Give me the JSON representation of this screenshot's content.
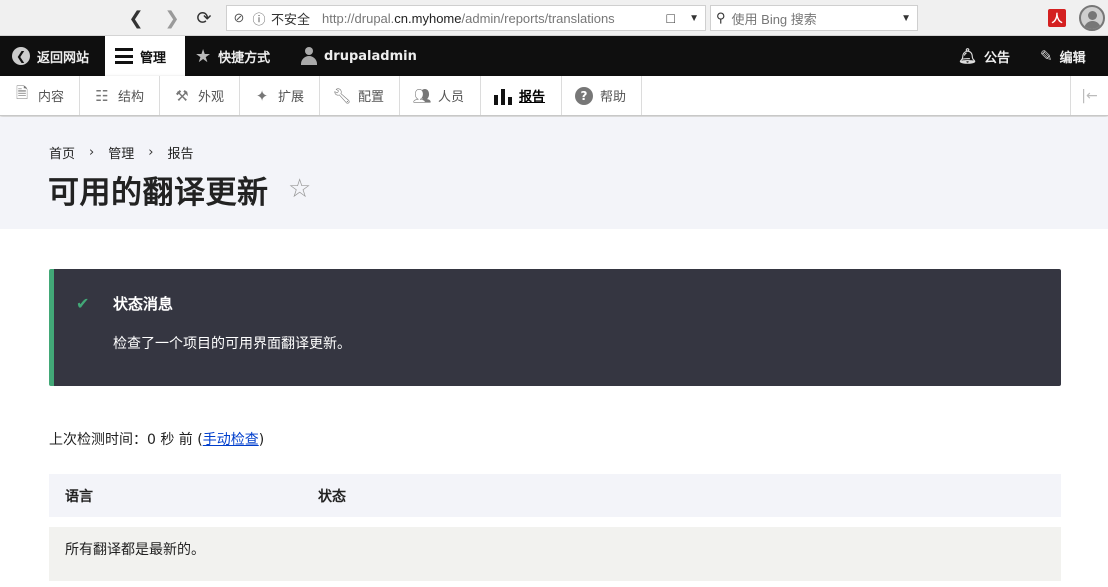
{
  "browser": {
    "insecure_label": "不安全",
    "url_prefix": "http://drupal.",
    "url_host": "cn.myhome",
    "url_path": "/admin/reports/translations",
    "search_placeholder": "使用 Bing 搜索",
    "pdf_icon_text": "人"
  },
  "toolbar": {
    "back_label": "返回网站",
    "manage_label": "管理",
    "shortcuts_label": "快捷方式",
    "user_label": "drupaladmin",
    "announcements_label": "公告",
    "edit_label": "编辑"
  },
  "tray": {
    "items": [
      {
        "label": "内容",
        "icon": "document-icon"
      },
      {
        "label": "结构",
        "icon": "sitemap-icon"
      },
      {
        "label": "外观",
        "icon": "brush-icon"
      },
      {
        "label": "扩展",
        "icon": "puzzle-icon"
      },
      {
        "label": "配置",
        "icon": "wrench-icon"
      },
      {
        "label": "人员",
        "icon": "people-icon"
      },
      {
        "label": "报告",
        "icon": "bar-chart-icon"
      },
      {
        "label": "帮助",
        "icon": "help-icon"
      }
    ]
  },
  "breadcrumb": [
    "首页",
    "管理",
    "报告"
  ],
  "page": {
    "title": "可用的翻译更新"
  },
  "status": {
    "heading": "状态消息",
    "message": "检查了一个项目的可用界面翻译更新。"
  },
  "last_check": {
    "prefix": "上次检测时间：0 秒 前 (",
    "link": "手动检查",
    "suffix": ")"
  },
  "table": {
    "headers": [
      "语言",
      "状态"
    ],
    "empty_message": "所有翻译都是最新的。"
  },
  "colors": {
    "toolbar_bg": "#0f0f0f",
    "status_bg": "#353641",
    "status_accent": "#42a877",
    "link": "#003ecc"
  }
}
